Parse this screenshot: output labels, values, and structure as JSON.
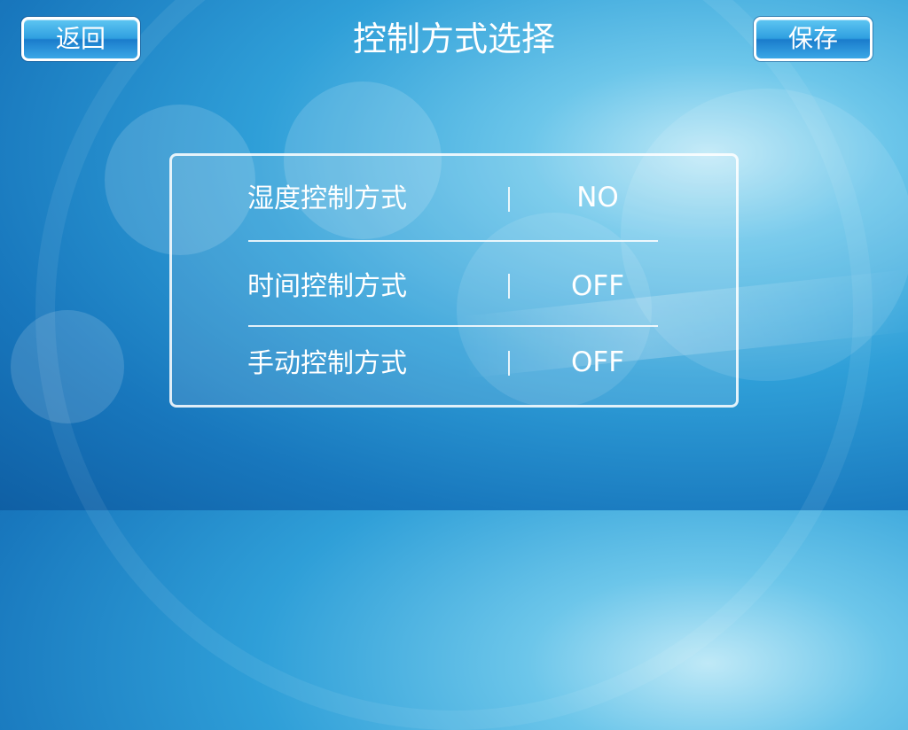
{
  "header": {
    "title": "控制方式选择",
    "back_label": "返回",
    "save_label": "保存"
  },
  "modes": [
    {
      "label": "湿度控制方式",
      "value": "NO"
    },
    {
      "label": "时间控制方式",
      "value": "OFF"
    },
    {
      "label": "手动控制方式",
      "value": "OFF"
    }
  ],
  "colors": {
    "background_primary": "#1877bd",
    "background_light": "#6cc6ea",
    "button_gradient_top": "#5ec6f2",
    "button_gradient_bottom": "#1a7ccc",
    "text": "#ffffff"
  }
}
